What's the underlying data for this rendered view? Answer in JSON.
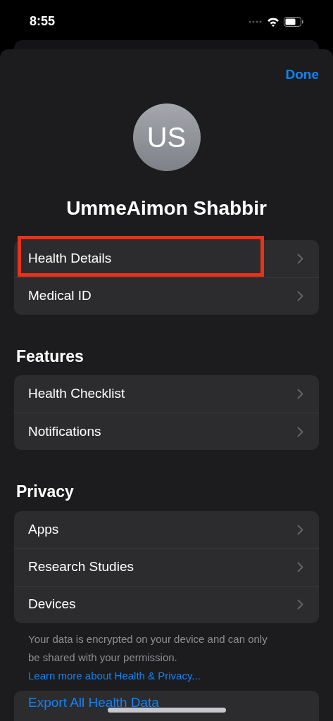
{
  "status_bar": {
    "time": "8:55"
  },
  "done_button": "Done",
  "profile": {
    "initials": "US",
    "name": "UmmeAimon Shabbir"
  },
  "groups": [
    {
      "items": [
        {
          "label": "Health Details",
          "highlighted": true
        },
        {
          "label": "Medical ID",
          "highlighted": false
        }
      ]
    },
    {
      "heading": "Features",
      "items": [
        {
          "label": "Health Checklist",
          "highlighted": false
        },
        {
          "label": "Notifications",
          "highlighted": false
        }
      ]
    },
    {
      "heading": "Privacy",
      "items": [
        {
          "label": "Apps",
          "highlighted": false
        },
        {
          "label": "Research Studies",
          "highlighted": false
        },
        {
          "label": "Devices",
          "highlighted": false
        }
      ]
    }
  ],
  "footer": {
    "text": "Your data is encrypted on your device and can only be shared with your permission.",
    "link": "Learn more about Health & Privacy..."
  },
  "export_button": "Export All Health Data"
}
